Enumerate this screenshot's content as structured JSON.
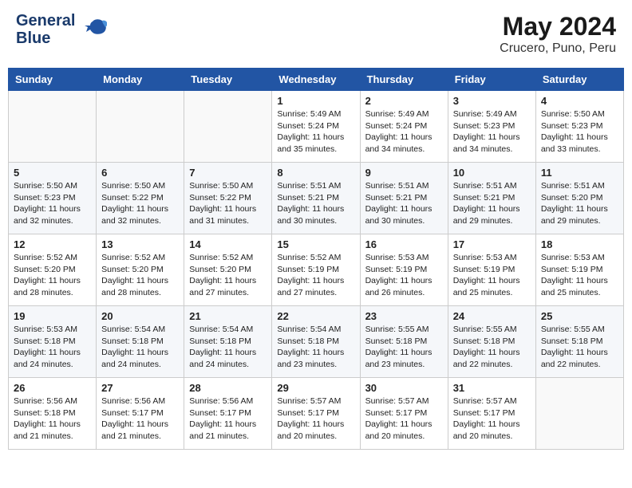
{
  "header": {
    "logo_line1": "General",
    "logo_line2": "Blue",
    "main_title": "May 2024",
    "subtitle": "Crucero, Puno, Peru"
  },
  "days_of_week": [
    "Sunday",
    "Monday",
    "Tuesday",
    "Wednesday",
    "Thursday",
    "Friday",
    "Saturday"
  ],
  "weeks": [
    [
      {
        "day": "",
        "info": ""
      },
      {
        "day": "",
        "info": ""
      },
      {
        "day": "",
        "info": ""
      },
      {
        "day": "1",
        "info": "Sunrise: 5:49 AM\nSunset: 5:24 PM\nDaylight: 11 hours\nand 35 minutes."
      },
      {
        "day": "2",
        "info": "Sunrise: 5:49 AM\nSunset: 5:24 PM\nDaylight: 11 hours\nand 34 minutes."
      },
      {
        "day": "3",
        "info": "Sunrise: 5:49 AM\nSunset: 5:23 PM\nDaylight: 11 hours\nand 34 minutes."
      },
      {
        "day": "4",
        "info": "Sunrise: 5:50 AM\nSunset: 5:23 PM\nDaylight: 11 hours\nand 33 minutes."
      }
    ],
    [
      {
        "day": "5",
        "info": "Sunrise: 5:50 AM\nSunset: 5:23 PM\nDaylight: 11 hours\nand 32 minutes."
      },
      {
        "day": "6",
        "info": "Sunrise: 5:50 AM\nSunset: 5:22 PM\nDaylight: 11 hours\nand 32 minutes."
      },
      {
        "day": "7",
        "info": "Sunrise: 5:50 AM\nSunset: 5:22 PM\nDaylight: 11 hours\nand 31 minutes."
      },
      {
        "day": "8",
        "info": "Sunrise: 5:51 AM\nSunset: 5:21 PM\nDaylight: 11 hours\nand 30 minutes."
      },
      {
        "day": "9",
        "info": "Sunrise: 5:51 AM\nSunset: 5:21 PM\nDaylight: 11 hours\nand 30 minutes."
      },
      {
        "day": "10",
        "info": "Sunrise: 5:51 AM\nSunset: 5:21 PM\nDaylight: 11 hours\nand 29 minutes."
      },
      {
        "day": "11",
        "info": "Sunrise: 5:51 AM\nSunset: 5:20 PM\nDaylight: 11 hours\nand 29 minutes."
      }
    ],
    [
      {
        "day": "12",
        "info": "Sunrise: 5:52 AM\nSunset: 5:20 PM\nDaylight: 11 hours\nand 28 minutes."
      },
      {
        "day": "13",
        "info": "Sunrise: 5:52 AM\nSunset: 5:20 PM\nDaylight: 11 hours\nand 28 minutes."
      },
      {
        "day": "14",
        "info": "Sunrise: 5:52 AM\nSunset: 5:20 PM\nDaylight: 11 hours\nand 27 minutes."
      },
      {
        "day": "15",
        "info": "Sunrise: 5:52 AM\nSunset: 5:19 PM\nDaylight: 11 hours\nand 27 minutes."
      },
      {
        "day": "16",
        "info": "Sunrise: 5:53 AM\nSunset: 5:19 PM\nDaylight: 11 hours\nand 26 minutes."
      },
      {
        "day": "17",
        "info": "Sunrise: 5:53 AM\nSunset: 5:19 PM\nDaylight: 11 hours\nand 25 minutes."
      },
      {
        "day": "18",
        "info": "Sunrise: 5:53 AM\nSunset: 5:19 PM\nDaylight: 11 hours\nand 25 minutes."
      }
    ],
    [
      {
        "day": "19",
        "info": "Sunrise: 5:53 AM\nSunset: 5:18 PM\nDaylight: 11 hours\nand 24 minutes."
      },
      {
        "day": "20",
        "info": "Sunrise: 5:54 AM\nSunset: 5:18 PM\nDaylight: 11 hours\nand 24 minutes."
      },
      {
        "day": "21",
        "info": "Sunrise: 5:54 AM\nSunset: 5:18 PM\nDaylight: 11 hours\nand 24 minutes."
      },
      {
        "day": "22",
        "info": "Sunrise: 5:54 AM\nSunset: 5:18 PM\nDaylight: 11 hours\nand 23 minutes."
      },
      {
        "day": "23",
        "info": "Sunrise: 5:55 AM\nSunset: 5:18 PM\nDaylight: 11 hours\nand 23 minutes."
      },
      {
        "day": "24",
        "info": "Sunrise: 5:55 AM\nSunset: 5:18 PM\nDaylight: 11 hours\nand 22 minutes."
      },
      {
        "day": "25",
        "info": "Sunrise: 5:55 AM\nSunset: 5:18 PM\nDaylight: 11 hours\nand 22 minutes."
      }
    ],
    [
      {
        "day": "26",
        "info": "Sunrise: 5:56 AM\nSunset: 5:18 PM\nDaylight: 11 hours\nand 21 minutes."
      },
      {
        "day": "27",
        "info": "Sunrise: 5:56 AM\nSunset: 5:17 PM\nDaylight: 11 hours\nand 21 minutes."
      },
      {
        "day": "28",
        "info": "Sunrise: 5:56 AM\nSunset: 5:17 PM\nDaylight: 11 hours\nand 21 minutes."
      },
      {
        "day": "29",
        "info": "Sunrise: 5:57 AM\nSunset: 5:17 PM\nDaylight: 11 hours\nand 20 minutes."
      },
      {
        "day": "30",
        "info": "Sunrise: 5:57 AM\nSunset: 5:17 PM\nDaylight: 11 hours\nand 20 minutes."
      },
      {
        "day": "31",
        "info": "Sunrise: 5:57 AM\nSunset: 5:17 PM\nDaylight: 11 hours\nand 20 minutes."
      },
      {
        "day": "",
        "info": ""
      }
    ]
  ]
}
